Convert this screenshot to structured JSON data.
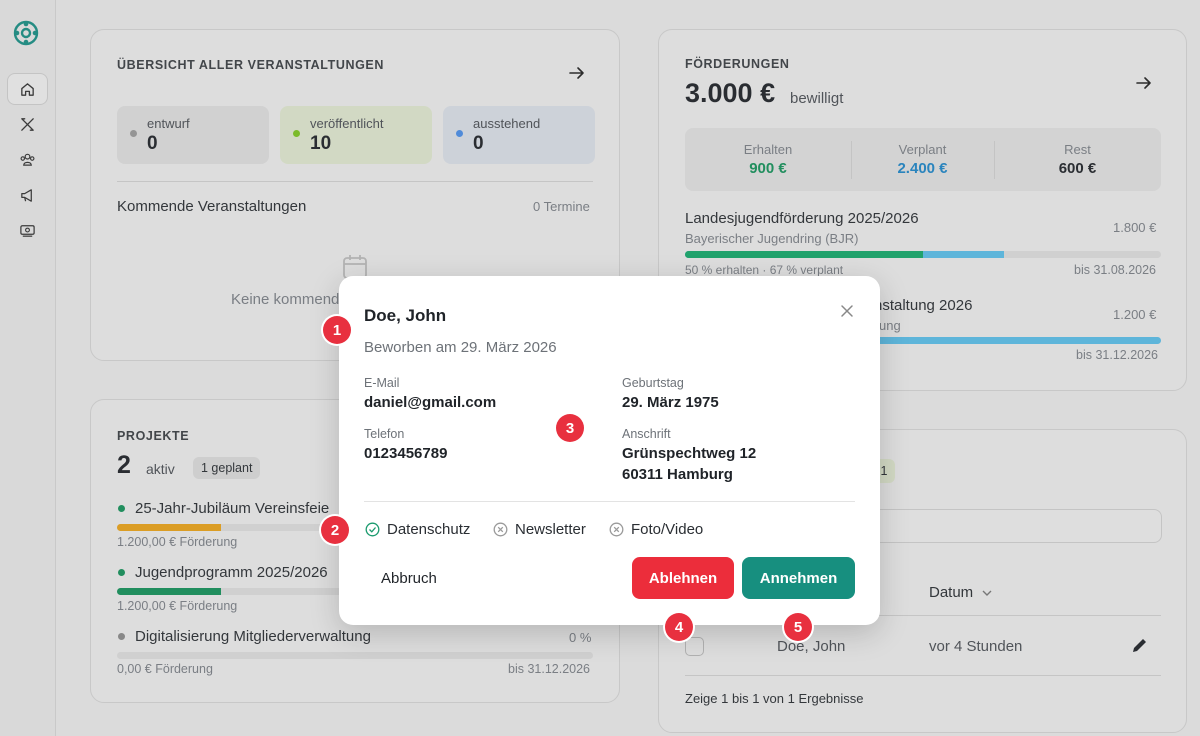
{
  "overview": {
    "title": "ÜBERSICHT ALLER VERANSTALTUNGEN",
    "stats": [
      {
        "label": "entwurf",
        "value": "0",
        "bg": "#dddddd",
        "dot": "#999999"
      },
      {
        "label": "veröffentlicht",
        "value": "10",
        "bg": "#dfe6cf",
        "dot": "#7cc41f"
      },
      {
        "label": "ausstehend",
        "value": "0",
        "bg": "#d9dee6",
        "dot": "#4a8ee6"
      }
    ],
    "upcoming_label": "Kommende Veranstaltungen",
    "upcoming_count": "0 Termine",
    "empty_text": "Keine kommend"
  },
  "funding": {
    "title": "FÖRDERUNGEN",
    "amount": "3.000 €",
    "amount_suffix": "bewilligt",
    "summary": [
      {
        "label": "Erhalten",
        "value": "900 €",
        "color": "#15915a"
      },
      {
        "label": "Verplant",
        "value": "2.400 €",
        "color": "#1f86c7"
      },
      {
        "label": "Rest",
        "value": "600 €",
        "color": "#1f2328"
      }
    ],
    "items": [
      {
        "name": "Landesjugendförderung 2025/2026",
        "org": "Bayerischer Jugendring (BJR)",
        "amount": "1.800 €",
        "note": "50 % erhalten · 67 % verplant",
        "due": "bis 31.08.2026",
        "received": 0.5,
        "planned": 0.67
      },
      {
        "name": "nstaltung 2026",
        "org": "ung",
        "amount": "1.200 €",
        "due": "bis 31.12.2026",
        "received": 0,
        "planned": 1.0
      }
    ]
  },
  "projects": {
    "title": "PROJEKTE",
    "count": "2",
    "count_suffix": "aktiv",
    "planned_badge": "1 geplant",
    "items": [
      {
        "name": "25-Jahr-Jubiläum Vereinsfeie",
        "funding": "1.200,00 € Förderung",
        "dot": "#15915a",
        "bar": "#e9a21a",
        "progress": 0.45
      },
      {
        "name": "Jugendprogramm 2025/2026",
        "funding": "1.200,00 € Förderung",
        "dot": "#15915a",
        "bar": "#15915a",
        "progress": 0.45
      },
      {
        "name": "Digitalisierung Mitgliederverwaltung",
        "funding": "0,00 € Förderung",
        "percent": "0 %",
        "due": "bis 31.12.2026",
        "dot": "#8a8a8a",
        "bar": "#8a8a8a",
        "progress": 0
      }
    ]
  },
  "applications": {
    "badge": "1",
    "col_date": "Datum",
    "row_name": "Doe, John",
    "row_time": "vor 4 Stunden",
    "footer": "Zeige 1 bis 1 von 1 Ergebnisse"
  },
  "modal": {
    "name": "Doe, John",
    "applied": "Beworben am 29. März 2026",
    "email_label": "E-Mail",
    "email": "daniel@gmail.com",
    "phone_label": "Telefon",
    "phone": "0123456789",
    "birthday_label": "Geburtstag",
    "birthday": "29. März 1975",
    "address_label": "Anschrift",
    "address_line1": "Grünspechtweg 12",
    "address_line2": "60311 Hamburg",
    "consents": [
      {
        "label": "Datenschutz",
        "state": "check-icon"
      },
      {
        "label": "Newsletter",
        "state": "x-circle-icon"
      },
      {
        "label": "Foto/Video",
        "state": "x-circle-icon"
      }
    ],
    "cancel": "Abbruch",
    "reject": "Ablehnen",
    "accept": "Annehmen",
    "reject_color": "#ec2d3b",
    "accept_color": "#178f7f"
  },
  "markers": [
    "1",
    "2",
    "3",
    "4",
    "5"
  ]
}
